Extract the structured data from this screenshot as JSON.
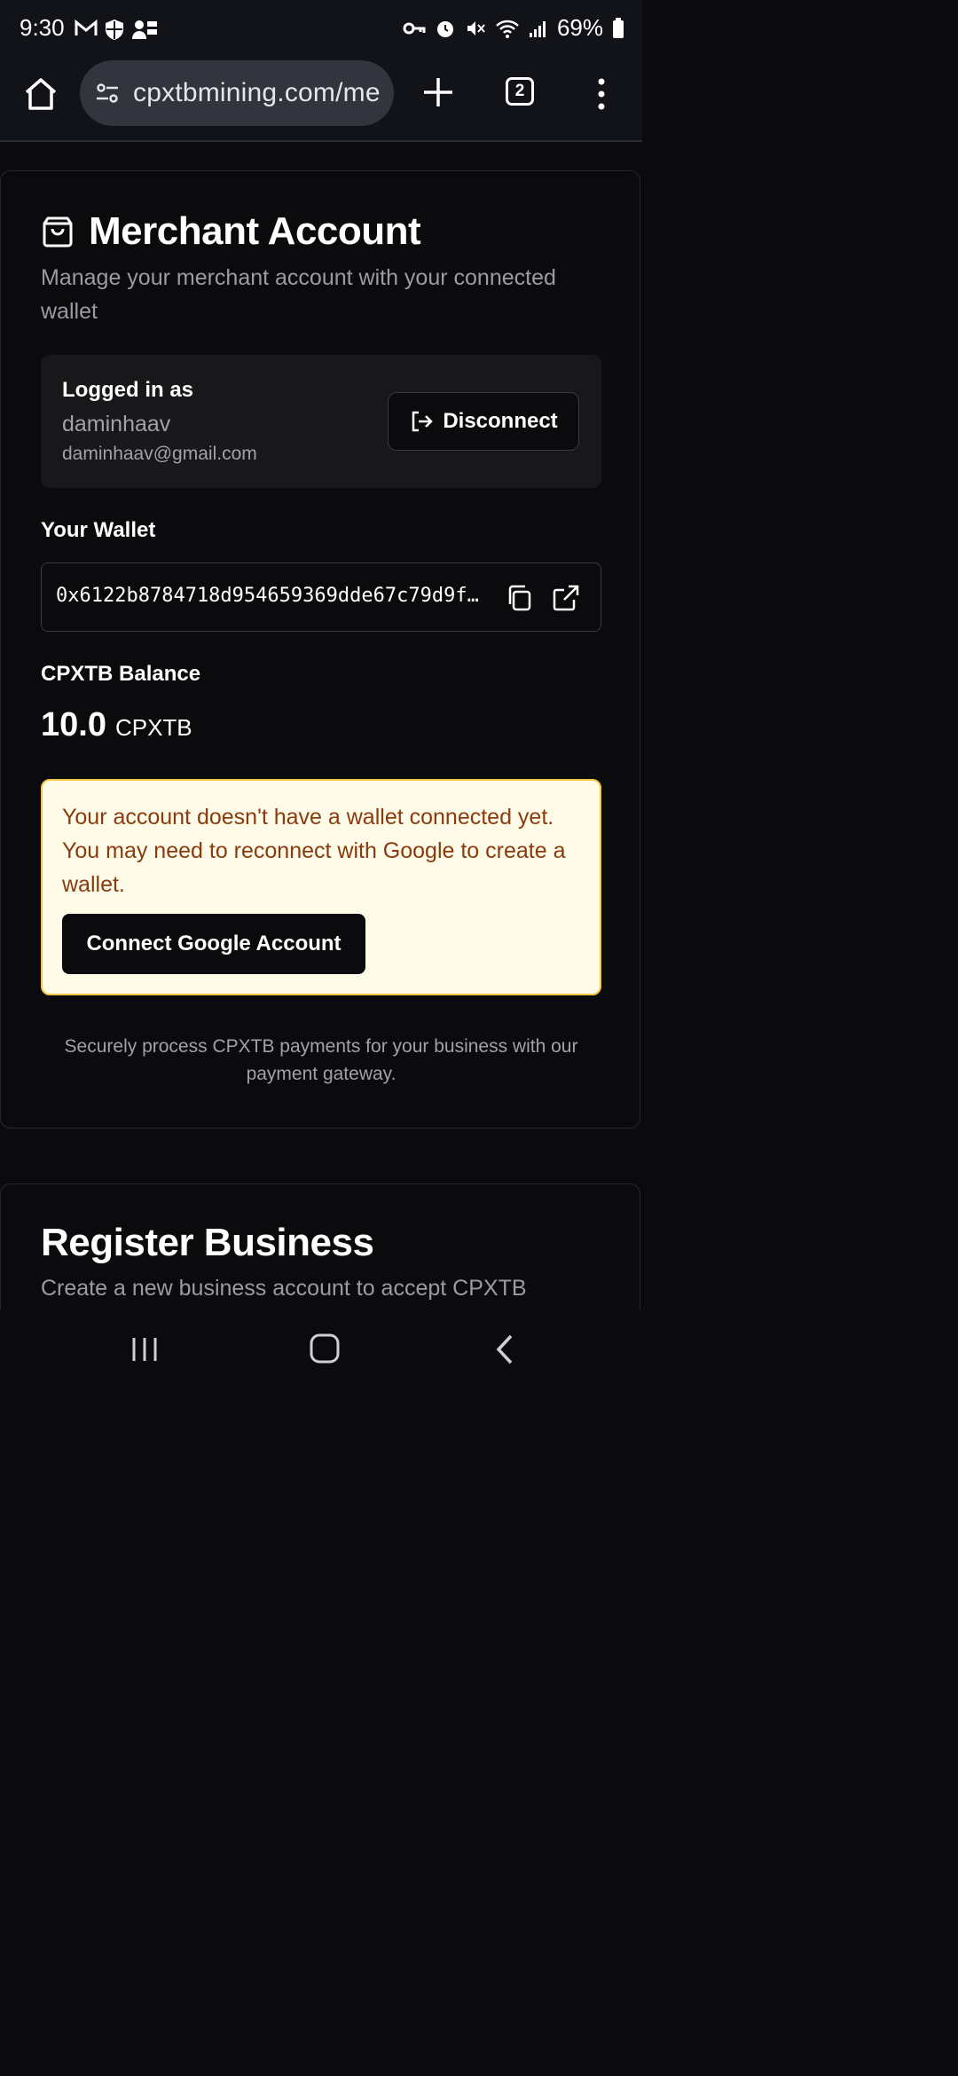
{
  "status_bar": {
    "time": "9:30",
    "left_icons": [
      "gmail-icon",
      "shield-icon",
      "contacts-icon"
    ],
    "right_icons": [
      "vpn-key-icon",
      "alarm-icon",
      "mute-icon",
      "wifi-icon",
      "signal-icon",
      "battery-icon"
    ],
    "battery": "69%"
  },
  "browser": {
    "url": "cpxtbmining.com/me",
    "tab_count": "2"
  },
  "merchant": {
    "title": "Merchant Account",
    "subtitle": "Manage your merchant account with your connected wallet",
    "logged_in_label": "Logged in as",
    "username": "daminhaav",
    "email": "daminhaav@gmail.com",
    "disconnect_label": "Disconnect",
    "wallet_label": "Your Wallet",
    "wallet_address": "0x6122b8784718d954659369dde67c79d9f…",
    "balance_label": "CPXTB Balance",
    "balance_value": "10.0",
    "balance_unit": "CPXTB",
    "warning_text": "Your account doesn't have a wallet connected yet. You may need to reconnect with Google to create a wallet.",
    "connect_google_label": "Connect Google Account",
    "footer_note": "Securely process CPXTB payments for your business with our payment gateway."
  },
  "register": {
    "title": "Register Business",
    "subtitle": "Create a new business account to accept CPXTB"
  },
  "colors": {
    "background": "#0b0b0d",
    "warning_bg": "#fefbe8",
    "warning_border": "#f5c542",
    "warning_text": "#8a3b0e"
  }
}
